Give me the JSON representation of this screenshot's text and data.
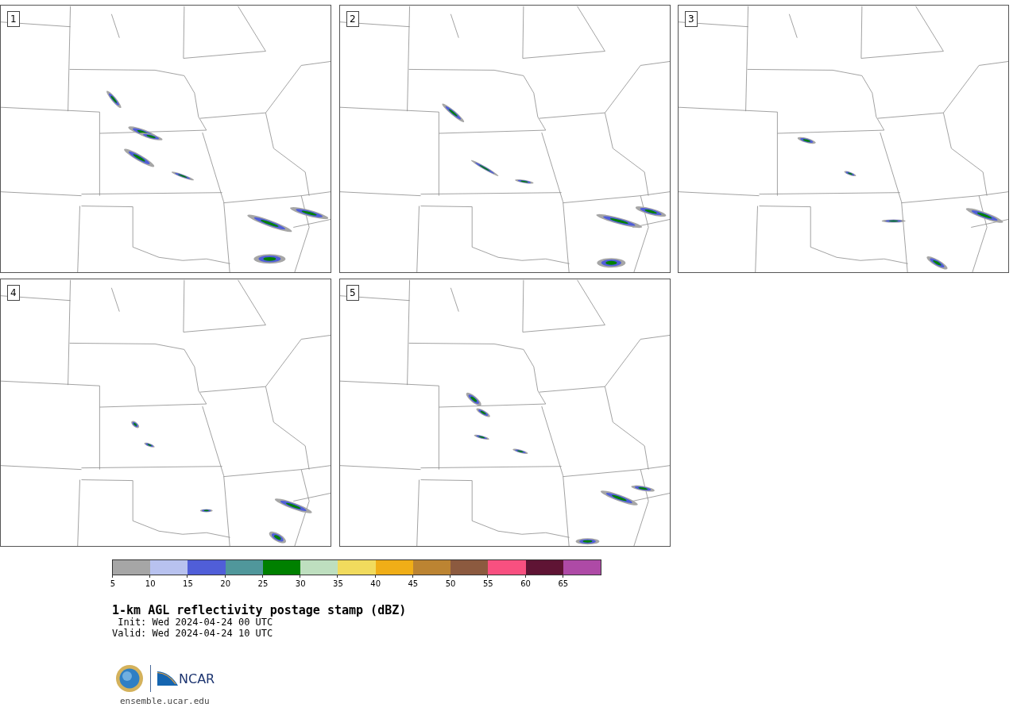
{
  "panels": [
    {
      "label": "1"
    },
    {
      "label": "2"
    },
    {
      "label": "3"
    },
    {
      "label": "4"
    },
    {
      "label": "5"
    }
  ],
  "colorbar": {
    "bins": [
      {
        "color": "#a6a6a6",
        "label": "5"
      },
      {
        "color": "#b8c2ef",
        "label": "10"
      },
      {
        "color": "#505ed8",
        "label": "15"
      },
      {
        "color": "#50979b",
        "label": "20"
      },
      {
        "color": "#008000",
        "label": "25"
      },
      {
        "color": "#bedfbf",
        "label": "30"
      },
      {
        "color": "#f1db5d",
        "label": "35"
      },
      {
        "color": "#f0ae17",
        "label": "40"
      },
      {
        "color": "#bc8432",
        "label": "45"
      },
      {
        "color": "#8c5a3f",
        "label": "50"
      },
      {
        "color": "#f85080",
        "label": "55"
      },
      {
        "color": "#5f1434",
        "label": "60"
      },
      {
        "color": "#ae4aa6",
        "label": "65"
      }
    ]
  },
  "title": "1-km AGL reflectivity postage stamp (dBZ)",
  "init": " Init: Wed 2024-04-24 00 UTC",
  "valid": "Valid: Wed 2024-04-24 10 UTC",
  "logo_text": "NCAR",
  "site": "ensemble.ucar.edu"
}
